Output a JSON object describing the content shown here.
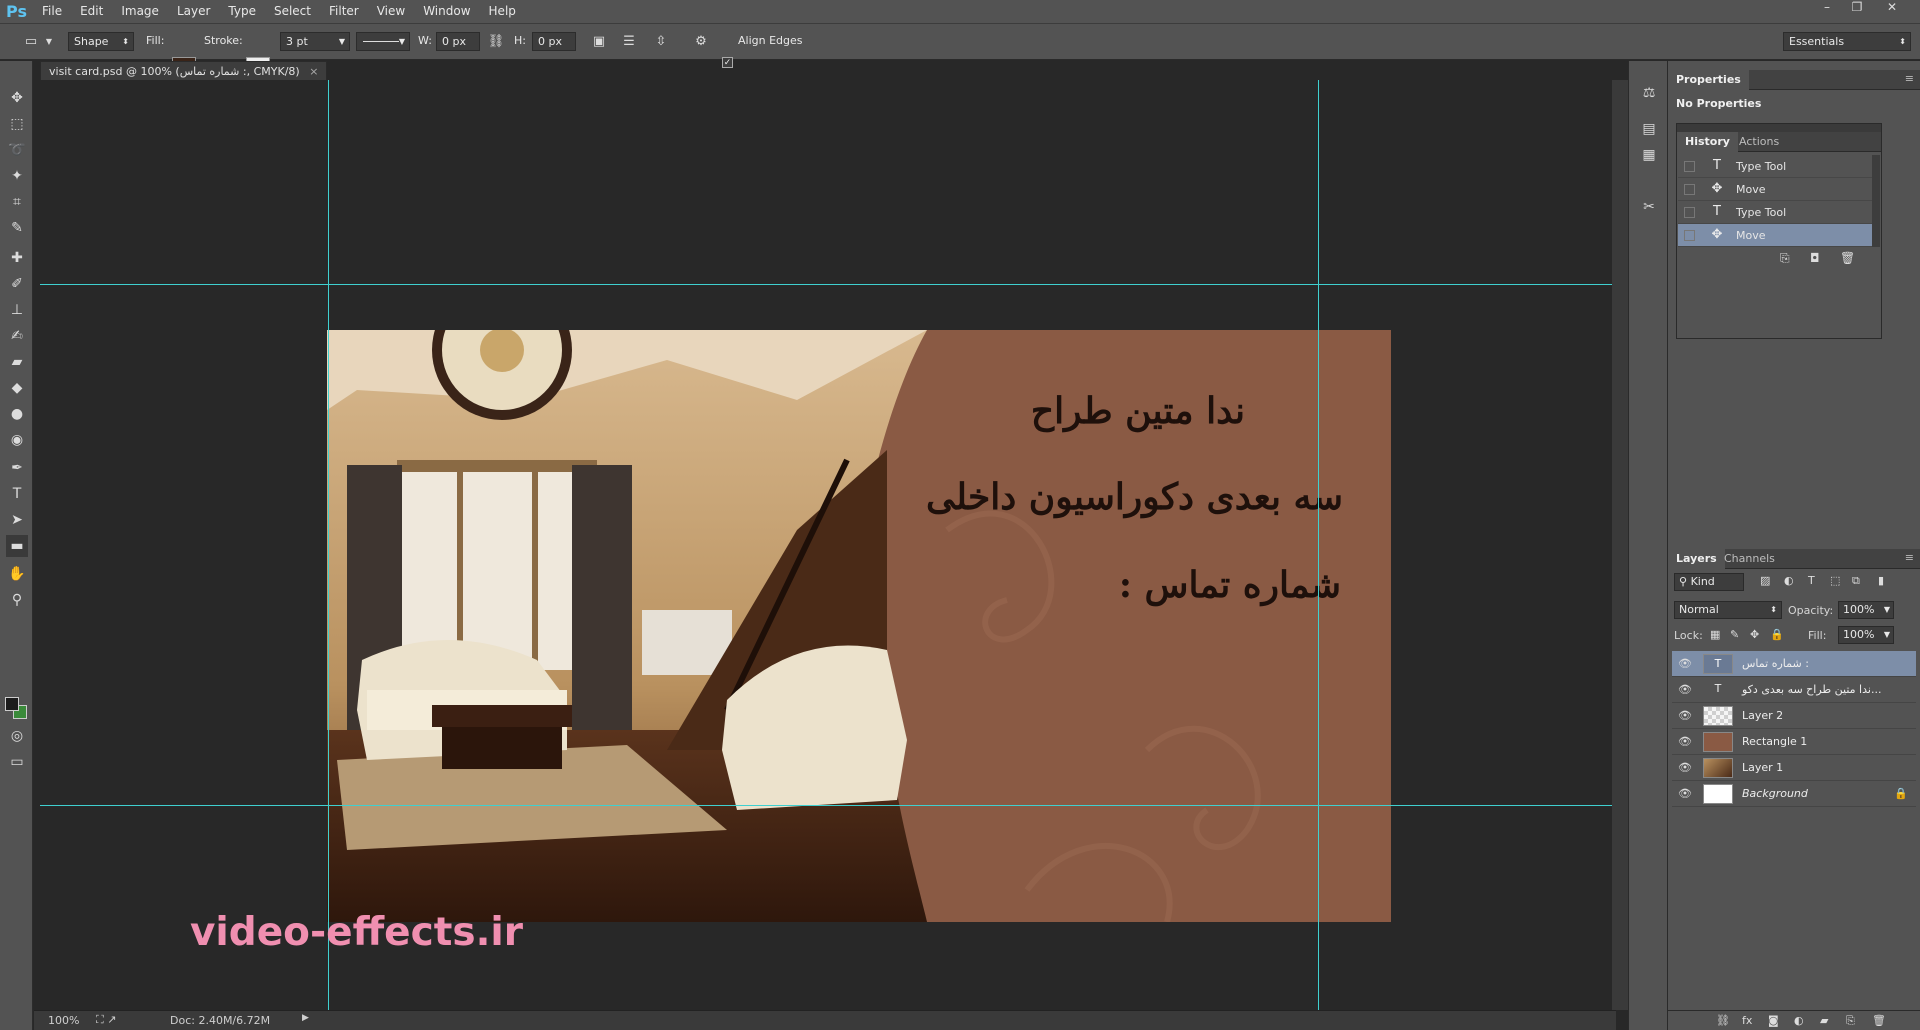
{
  "app": {
    "logo": "Ps"
  },
  "menu": [
    "File",
    "Edit",
    "Image",
    "Layer",
    "Type",
    "Select",
    "Filter",
    "View",
    "Window",
    "Help"
  ],
  "window_controls": {
    "minimize": "–",
    "restore": "❐",
    "close": "✕"
  },
  "options_bar": {
    "tool_mode": "Shape",
    "fill_label": "Fill:",
    "stroke_label": "Stroke:",
    "stroke_width": "3 pt",
    "w_label": "W:",
    "w_value": "0 px",
    "h_label": "H:",
    "h_value": "0 px",
    "align_edges_label": "Align Edges",
    "align_edges_checked": true,
    "workspace": "Essentials",
    "fill_color": "#3a2418"
  },
  "document": {
    "tab_title": "visit card.psd @ 100% (شماره تماس :, CMYK/8)",
    "tab_close": "×",
    "zoom": "100%",
    "doc_size": "Doc: 2.40M/6.72M"
  },
  "card": {
    "line1": "ندا متین طراح",
    "line2": "سه بعدی دکوراسیون داخلی",
    "line3": "شماره تماس :",
    "bg_color": "#8a5a44",
    "text_color": "#1e100b"
  },
  "watermark": "video-effects.ir",
  "properties_panel": {
    "tab": "Properties",
    "content": "No Properties"
  },
  "history_panel": {
    "tabs": [
      "History",
      "Actions"
    ],
    "items": [
      {
        "icon": "type-tool-icon",
        "glyph": "T",
        "label": "Type Tool",
        "selected": false
      },
      {
        "icon": "move-tool-icon",
        "glyph": "✥",
        "label": "Move",
        "selected": false
      },
      {
        "icon": "type-tool-icon",
        "glyph": "T",
        "label": "Type Tool",
        "selected": false
      },
      {
        "icon": "move-tool-icon",
        "glyph": "✥",
        "label": "Move",
        "selected": true
      }
    ]
  },
  "layers_panel": {
    "tabs": [
      "Layers",
      "Channels"
    ],
    "filter_kind": "Kind",
    "blend_mode": "Normal",
    "opacity_label": "Opacity:",
    "opacity_value": "100%",
    "lock_label": "Lock:",
    "fill_label": "Fill:",
    "fill_value": "100%",
    "layers": [
      {
        "name": "شماره تماس :",
        "kind": "text",
        "selected": true
      },
      {
        "name": "ندا متین طراح  سه بعدی دکو...",
        "kind": "text",
        "selected": false
      },
      {
        "name": "Layer 2",
        "kind": "pixel",
        "selected": false
      },
      {
        "name": "Rectangle 1",
        "kind": "shape",
        "selected": false
      },
      {
        "name": "Layer 1",
        "kind": "image",
        "selected": false
      },
      {
        "name": "Background",
        "kind": "background",
        "selected": false,
        "locked": true
      }
    ]
  },
  "colors": {
    "selection": "#7d8ea8",
    "guide": "#3fd0d0",
    "watermark": "#f08fb0",
    "foreground_swatch": "#1c1c1c",
    "background_swatch": "#3a8a3a"
  }
}
